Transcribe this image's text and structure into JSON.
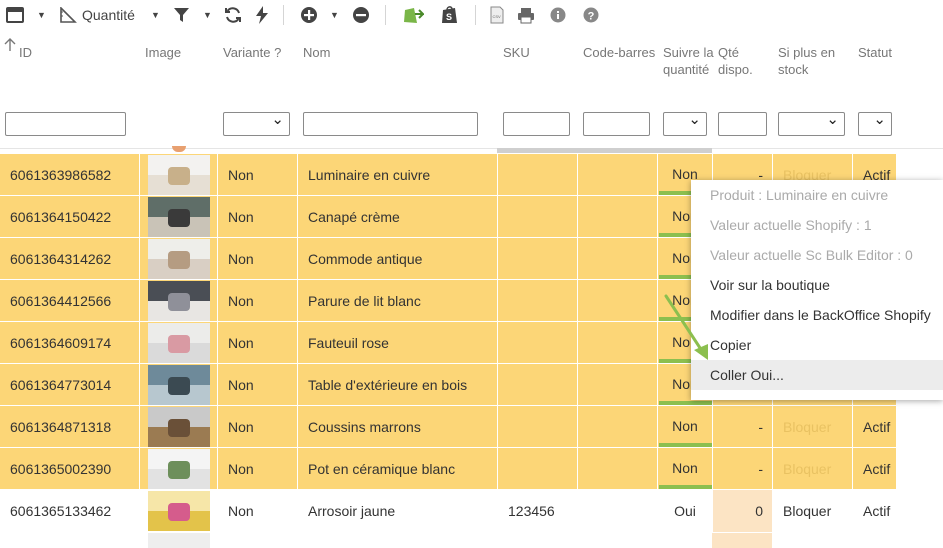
{
  "toolbar": {
    "quantity_label": "Quantité"
  },
  "columns": {
    "id": "ID",
    "image": "Image",
    "variant": "Variante ?",
    "name": "Nom",
    "sku": "SKU",
    "barcode": "Code-barres",
    "track_qty": "Suivre la quantité",
    "available_qty": "Qté dispo.",
    "if_out_of_stock": "Si plus en stock",
    "status": "Statut"
  },
  "rows": [
    {
      "id": "6061363986582",
      "variant": "Non",
      "name": "Luminaire en cuivre",
      "sku": "",
      "track": "Non",
      "qty": "-",
      "stock": "Bloquer",
      "status": "Actif"
    },
    {
      "id": "6061364150422",
      "variant": "Non",
      "name": "Canapé crème",
      "sku": "",
      "track": "Non",
      "qty": "",
      "stock": "",
      "status": ""
    },
    {
      "id": "6061364314262",
      "variant": "Non",
      "name": "Commode antique",
      "sku": "",
      "track": "Non",
      "qty": "",
      "stock": "",
      "status": ""
    },
    {
      "id": "6061364412566",
      "variant": "Non",
      "name": "Parure de lit blanc",
      "sku": "",
      "track": "Non",
      "qty": "",
      "stock": "",
      "status": ""
    },
    {
      "id": "6061364609174",
      "variant": "Non",
      "name": "Fauteuil rose",
      "sku": "",
      "track": "Non",
      "qty": "",
      "stock": "",
      "status": ""
    },
    {
      "id": "6061364773014",
      "variant": "Non",
      "name": "Table d'extérieure en bois",
      "sku": "",
      "track": "Non",
      "qty": "",
      "stock": "",
      "status": ""
    },
    {
      "id": "6061364871318",
      "variant": "Non",
      "name": "Coussins marrons",
      "sku": "",
      "track": "Non",
      "qty": "-",
      "stock": "Bloquer",
      "status": "Actif"
    },
    {
      "id": "6061365002390",
      "variant": "Non",
      "name": "Pot en céramique blanc",
      "sku": "",
      "track": "Non",
      "qty": "-",
      "stock": "Bloquer",
      "status": "Actif"
    },
    {
      "id": "6061365133462",
      "variant": "Non",
      "name": "Arrosoir jaune",
      "sku": "123456",
      "track": "Oui",
      "qty": "0",
      "stock": "Bloquer",
      "status": "Actif"
    }
  ],
  "context_menu": {
    "items": [
      "Produit : Luminaire en cuivre",
      "Valeur actuelle Shopify : 1",
      "Valeur actuelle Sc Bulk Editor : 0",
      "Voir sur la boutique",
      "Modifier dans le BackOffice Shopify",
      "Copier",
      "Coller Oui..."
    ]
  },
  "colors": {
    "row_highlight": "#fcd677",
    "accent_green": "#8cbf4f",
    "arrow": "#8cbf4f"
  }
}
